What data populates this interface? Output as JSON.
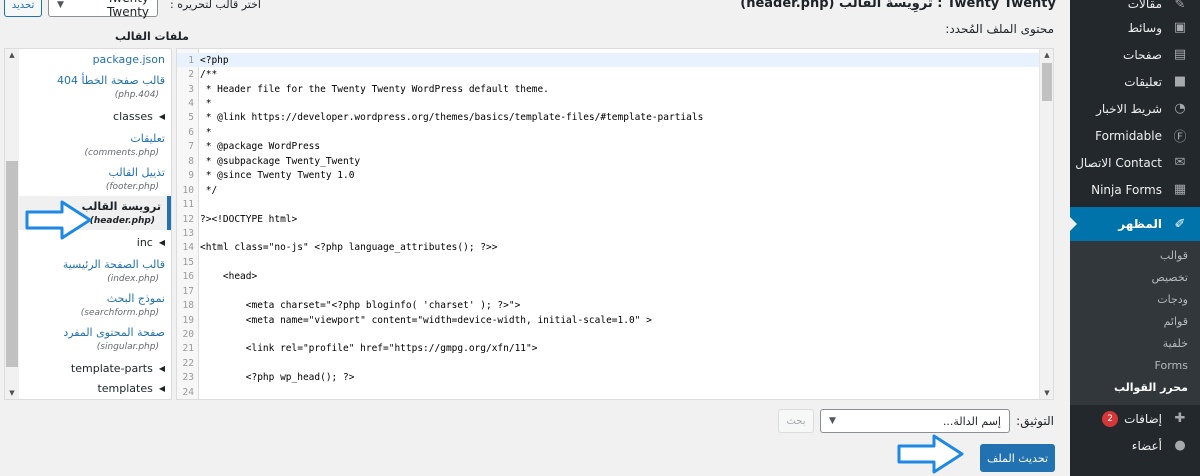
{
  "header": {
    "title": "Twenty Twenty : تروِيسة القالب (header.php)",
    "select_theme_label": "اختر قالب لتحريره :",
    "selected_theme": "Twenty Twenty",
    "select_button": "تحديد"
  },
  "editor": {
    "content_label": "محتوى الملف المُحدد:",
    "files_title": "ملفات القالب",
    "lines": [
      {
        "n": "1",
        "text": "<?php"
      },
      {
        "n": "2",
        "text": "/**"
      },
      {
        "n": "3",
        "text": " * Header file for the Twenty Twenty WordPress default theme."
      },
      {
        "n": "4",
        "text": " *"
      },
      {
        "n": "5",
        "text": " * @link https://developer.wordpress.org/themes/basics/template-files/#template-partials"
      },
      {
        "n": "6",
        "text": " *"
      },
      {
        "n": "7",
        "text": " * @package WordPress"
      },
      {
        "n": "8",
        "text": " * @subpackage Twenty_Twenty"
      },
      {
        "n": "9",
        "text": " * @since Twenty Twenty 1.0"
      },
      {
        "n": "10",
        "text": " */"
      },
      {
        "n": "11",
        "text": ""
      },
      {
        "n": "12",
        "text": "?><!DOCTYPE html>"
      },
      {
        "n": "13",
        "text": ""
      },
      {
        "n": "14",
        "text": "<html class=\"no-js\" <?php language_attributes(); ?>>"
      },
      {
        "n": "15",
        "text": ""
      },
      {
        "n": "16",
        "text": "    <head>"
      },
      {
        "n": "17",
        "text": ""
      },
      {
        "n": "18",
        "text": "        <meta charset=\"<?php bloginfo( 'charset' ); ?>\">"
      },
      {
        "n": "19",
        "text": "        <meta name=\"viewport\" content=\"width=device-width, initial-scale=1.0\" >"
      },
      {
        "n": "20",
        "text": ""
      },
      {
        "n": "21",
        "text": "        <link rel=\"profile\" href=\"https://gmpg.org/xfn/11\">"
      },
      {
        "n": "22",
        "text": ""
      },
      {
        "n": "23",
        "text": "        <?php wp_head(); ?>"
      },
      {
        "n": "24",
        "text": ""
      }
    ]
  },
  "files": {
    "package_json": "package.json",
    "f404_name": "قالب صفحة الخطأ 404",
    "f404_path": "(404.php)",
    "classes": "classes",
    "comments_name": "تعليقات",
    "comments_path": "(comments.php)",
    "footer_name": "تذييل القالب",
    "footer_path": "(footer.php)",
    "header_name": "ترويسة القالب",
    "header_path": "(header.php)",
    "inc": "inc",
    "index_name": "قالب الصفحة الرئيسية",
    "index_path": "(index.php)",
    "search_name": "نموذج البحث",
    "search_path": "(searchform.php)",
    "singular_name": "صفحة المحتوى المفرد",
    "singular_path": "(singular.php)",
    "template_parts": "template-parts",
    "templates": "templates"
  },
  "bottom": {
    "doc_label": "التوثيق:",
    "doc_placeholder": "إسم الدالة...",
    "lookup_button": "بحث",
    "update_button": "تحديث الملف"
  },
  "sidebar": {
    "posts": "مقالات",
    "media": "وسائط",
    "pages": "صفحات",
    "comments": "تعليقات",
    "news_ticker": "شريط الاخبار",
    "formidable": "Formidable",
    "contact": "Contact الاتصال",
    "ninja": "Ninja Forms",
    "appearance": "المظهر",
    "sub_themes": "قوالب",
    "sub_customize": "تخصيص",
    "sub_widgets": "ودجات",
    "sub_menus": "قوائم",
    "sub_background": "خلفية",
    "sub_forms": "Forms",
    "sub_editor": "محرر القوالب",
    "plugins": "إضافات",
    "plugins_count": "2",
    "users": "أعضاء"
  },
  "colors": {
    "sidebar_bg": "#23282d",
    "accent": "#0073aa",
    "button_blue": "#2271b1"
  }
}
